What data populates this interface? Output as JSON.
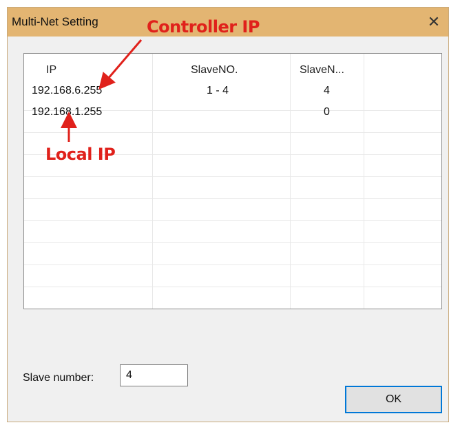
{
  "window": {
    "title": "Multi-Net Setting",
    "close_glyph": "✕"
  },
  "annotations": {
    "controller_ip": "Controller IP",
    "local_ip": "Local IP",
    "color": "#e0211b"
  },
  "table": {
    "columns": [
      "IP",
      "SlaveNO.",
      "SlaveN..."
    ],
    "rows": [
      [
        "192.168.6.255",
        "1 - 4",
        "4"
      ],
      [
        "192.168.1.255",
        "",
        "0"
      ]
    ]
  },
  "form": {
    "slave_number_label": "Slave number:",
    "slave_number_value": "4"
  },
  "buttons": {
    "ok_label": "OK"
  },
  "colors": {
    "titlebar": "#e3b572",
    "dialog_bg": "#f0f0f0",
    "ok_border": "#0078d7"
  }
}
